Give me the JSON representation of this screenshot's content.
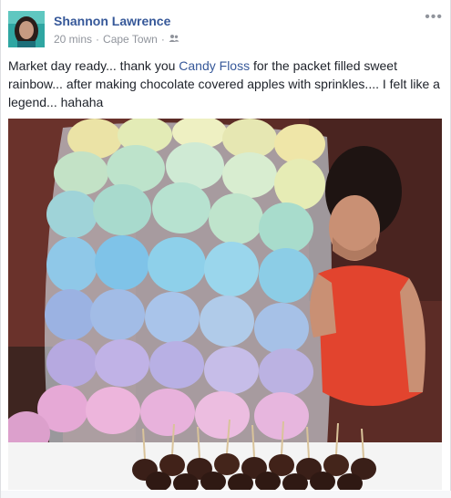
{
  "post": {
    "author": "Shannon Lawrence",
    "time": "20 mins",
    "location": "Cape Town",
    "separator": "·",
    "audience_icon": "friends-icon",
    "more_icon": "more-options-icon",
    "more_glyph": "•••",
    "text_before": "Market day ready... thank you ",
    "mention": "Candy Floss",
    "text_after": " for the packet filled sweet rainbow... after making chocolate covered apples with sprinkles.... I felt like a legend... hahaha"
  },
  "colors": {
    "author_link": "#365899",
    "meta_text": "#90949c",
    "body_text": "#1d2129"
  }
}
